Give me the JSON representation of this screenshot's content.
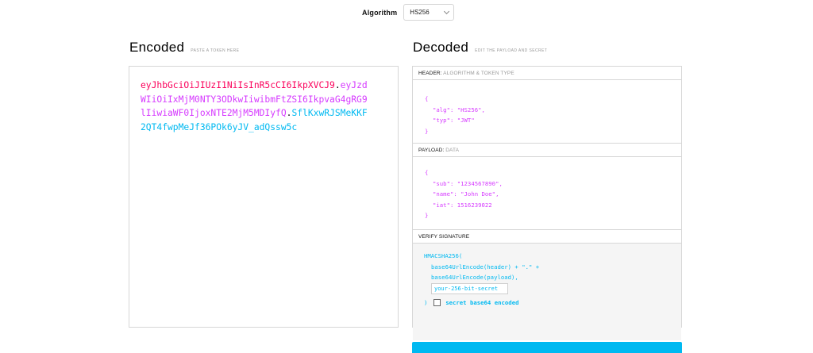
{
  "algorithm": {
    "label": "Algorithm",
    "selected": "HS256"
  },
  "encoded": {
    "title": "Encoded",
    "hint": "PASTE A TOKEN HERE",
    "token_header": "eyJhbGciOiJIUzI1NiIsInR5cCI6IkpXVCJ9",
    "token_payload": "eyJzdWIiOiIxMjM0NTY3ODkwIiwibmFtZSI6IkpvaG4gRG9lIiwiaWF0IjoxNTE2MjM5MDIyfQ",
    "token_signature": "SflKxwRJSMeKKF2QT4fwpMeJf36POk6yJV_adQssw5c",
    "dot": "."
  },
  "decoded": {
    "title": "Decoded",
    "hint": "EDIT THE PAYLOAD AND SECRET",
    "header": {
      "title": "HEADER:",
      "subtitle": "ALGORITHM & TOKEN TYPE",
      "lines": [
        "{",
        "\"alg\": \"HS256\",",
        "\"typ\": \"JWT\"",
        "}"
      ]
    },
    "payload": {
      "title": "PAYLOAD:",
      "subtitle": "DATA",
      "lines": [
        "{",
        "\"sub\": \"1234567890\",",
        "\"name\": \"John Doe\",",
        "\"iat\": 1516239022",
        "}"
      ]
    },
    "verify": {
      "title": "VERIFY SIGNATURE",
      "fn": "HMACSHA256(",
      "line1": "base64UrlEncode(header) + \".\" +",
      "line2": "base64UrlEncode(payload),",
      "secret_placeholder": "your-256-bit-secret",
      "close": ")",
      "checkbox_label": "secret base64 encoded"
    }
  },
  "colors": {
    "header": "#fb015b",
    "payload": "#d63aff",
    "signature": "#00b9f1"
  }
}
